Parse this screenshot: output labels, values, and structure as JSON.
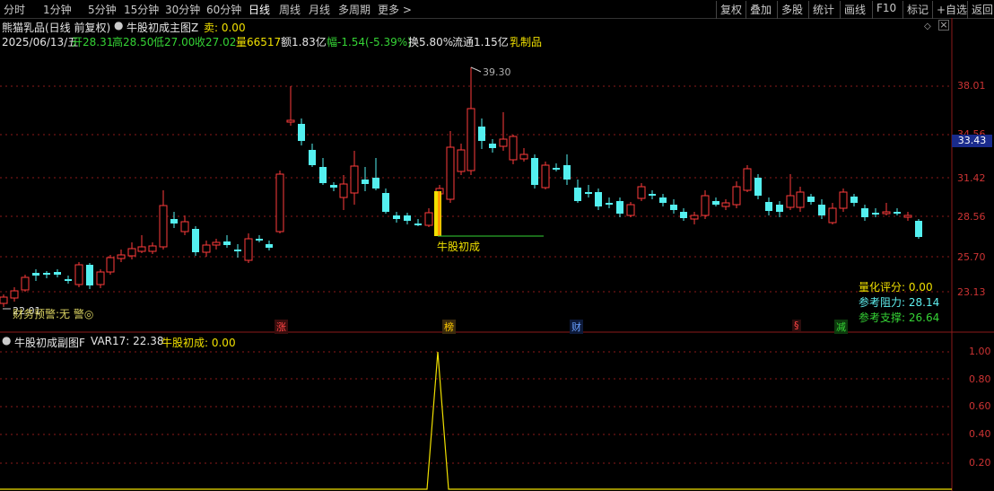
{
  "toolbar": {
    "periods": [
      "分时",
      "1分钟",
      "5分钟",
      "15分钟",
      "30分钟",
      "60分钟",
      "日线",
      "周线",
      "月线",
      "多周期",
      "更多 >"
    ],
    "active": "日线",
    "right": [
      "复权",
      "叠加",
      "多股",
      "统计",
      "画线",
      "F10",
      "标记",
      "+自选",
      "返回"
    ]
  },
  "header": {
    "stock_name": "熊猫乳品(日线 前复权)",
    "indicator": "牛股初成主图Z",
    "sell_label": "卖: 0.00",
    "date": "2025/06/13/五",
    "open": "开28.31",
    "high": "高28.50",
    "low": "低27.00",
    "close": "收27.02",
    "volume": "量66517",
    "amount": "额1.83亿",
    "change": "幅-1.54(-5.39%)",
    "turnover": "换5.80%",
    "float": "流通1.15亿",
    "sector": "乳制品"
  },
  "price_axis": [
    "38.01",
    "34.56",
    "31.42",
    "28.56",
    "25.70",
    "23.13"
  ],
  "current_price": "33.43",
  "peak_label": "39.30",
  "low_label": "22.01",
  "signal_label": "牛股初成",
  "score_panel": {
    "score": "量化评分: 0.00",
    "resistance": "参考阻力: 28.14",
    "support": "参考支撑: 26.64"
  },
  "alert": "财务预警:无 警◎",
  "markers": [
    {
      "text": "涨",
      "color": "#ff4444"
    },
    {
      "text": "榜",
      "color": "#ffcc00"
    },
    {
      "text": "财",
      "color": "#4a8cff"
    },
    {
      "text": "§",
      "color": "#ff4444"
    },
    {
      "text": "减",
      "color": "#35d335"
    }
  ],
  "sub_header": {
    "title": "牛股初成副图F",
    "var17": "VAR17: 22.38",
    "signal": "牛股初成: 0.00"
  },
  "sub_axis": [
    "1.00",
    "0.80",
    "0.60",
    "0.40",
    "0.20"
  ],
  "colors": {
    "up": "#ff3b3b",
    "down": "#54f0f0",
    "grid": "#8b1a1a",
    "signal": "#f0e000"
  }
}
